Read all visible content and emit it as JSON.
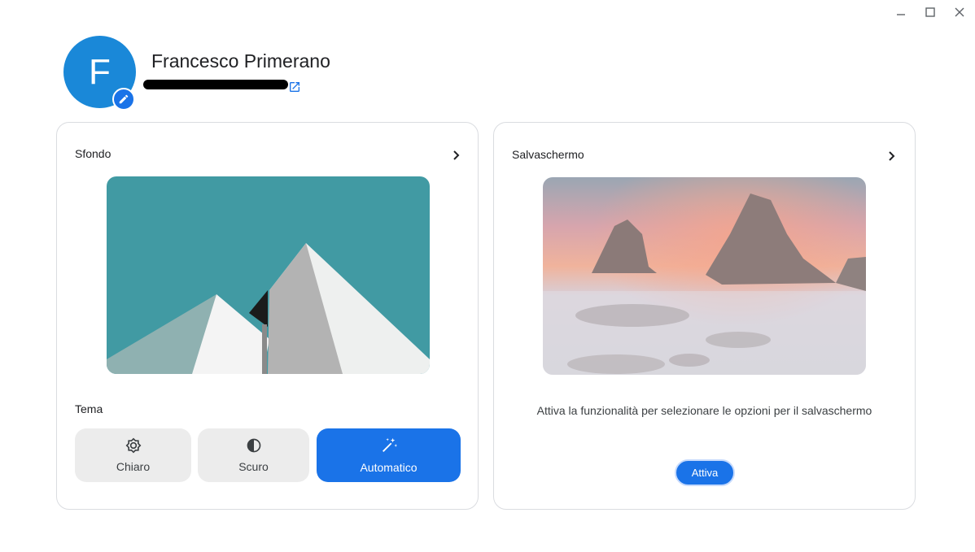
{
  "window": {
    "controls": [
      {
        "name": "minimize-icon"
      },
      {
        "name": "maximize-icon"
      },
      {
        "name": "close-icon"
      }
    ]
  },
  "profile": {
    "avatar_letter": "F",
    "name": "Francesco Primerano",
    "avatar_color": "#1a88d8"
  },
  "wallpaper_card": {
    "title": "Sfondo",
    "theme_label": "Tema",
    "themes": [
      {
        "label": "Chiaro",
        "icon": "brightness-icon",
        "selected": false
      },
      {
        "label": "Scuro",
        "icon": "contrast-icon",
        "selected": false
      },
      {
        "label": "Automatico",
        "icon": "magic-wand-icon",
        "selected": true
      }
    ]
  },
  "screensaver_card": {
    "title": "Salvaschermo",
    "message": "Attiva la funzionalità per selezionare le opzioni per il salvaschermo",
    "activate_label": "Attiva"
  },
  "colors": {
    "accent": "#1a73e8",
    "wallpaper_bg": "#419aa3",
    "card_border": "#dadce0"
  }
}
